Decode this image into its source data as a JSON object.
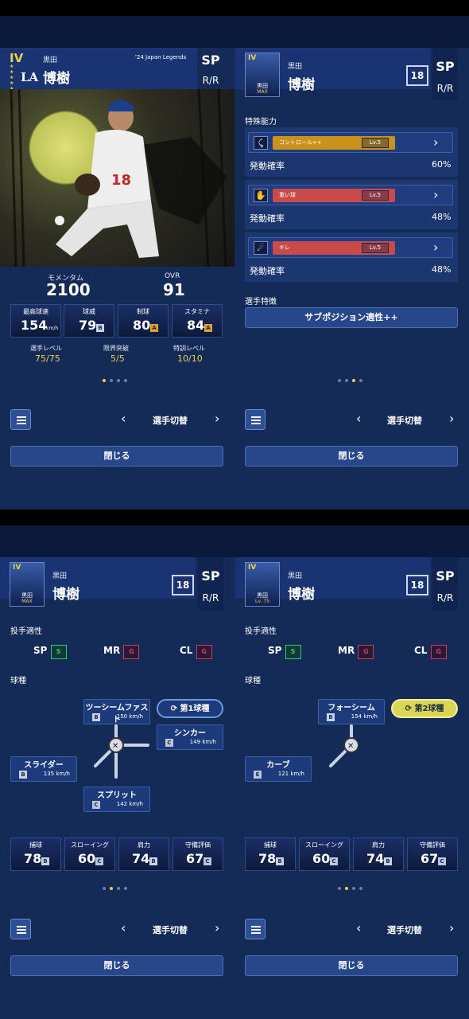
{
  "player": {
    "last_name": "黒田",
    "first_name": "博樹",
    "position": "SP",
    "throws_bats": "R/R",
    "number": "18",
    "series": "'24 Japan Legends",
    "grade": "IV",
    "team_logo": "LA",
    "thumb_max": "MAX",
    "thumb_lv": "Lv. 75"
  },
  "panel1": {
    "momentum_label": "モメンタム",
    "momentum_value": "2100",
    "ovr_label": "OVR",
    "ovr_value": "91",
    "stats": [
      {
        "label": "最高球速",
        "value": "154",
        "unit": "km/h"
      },
      {
        "label": "球威",
        "value": "79",
        "rank": "B"
      },
      {
        "label": "制球",
        "value": "80",
        "rank": "A"
      },
      {
        "label": "スタミナ",
        "value": "84",
        "rank": "A"
      }
    ],
    "levels": [
      {
        "label": "選手レベル",
        "value": "75/75"
      },
      {
        "label": "限界突破",
        "value": "5/5"
      },
      {
        "label": "特訓レベル",
        "value": "10/10"
      }
    ]
  },
  "panel2": {
    "special_title": "特殊能力",
    "rate_label": "発動確率",
    "skills": [
      {
        "name": "コントロール++",
        "lv": "Lv.5",
        "rate": "60%",
        "color": "#c9921a",
        "icon": "pitcher-throw-icon"
      },
      {
        "name": "重い球",
        "lv": "Lv.5",
        "rate": "48%",
        "color": "#c94a4a",
        "icon": "heavy-ball-icon"
      },
      {
        "name": "キレ",
        "lv": "Lv.5",
        "rate": "48%",
        "color": "#c94a4a",
        "icon": "sharp-break-icon"
      }
    ],
    "trait_title": "選手特徴",
    "trait_button": "サブポジション適性++"
  },
  "panel3": {
    "aptitude_title": "投手適性",
    "positions": [
      {
        "label": "SP",
        "rank": "S",
        "color": "#38c27a"
      },
      {
        "label": "MR",
        "rank": "G",
        "color": "#d23b4f"
      },
      {
        "label": "CL",
        "rank": "G",
        "color": "#d23b4f"
      }
    ],
    "pitch_title": "球種",
    "first_pitch_label": "第1球種",
    "pitches": [
      {
        "name": "ツーシームファスト",
        "rank": "B",
        "speed": "150 km/h"
      },
      {
        "name": "シンカー",
        "rank": "C",
        "speed": "149 km/h"
      },
      {
        "name": "スライダー",
        "rank": "B",
        "speed": "135 km/h"
      },
      {
        "name": "スプリット",
        "rank": "C",
        "speed": "142 km/h"
      }
    ]
  },
  "panel4": {
    "second_pitch_label": "第2球種",
    "pitches": [
      {
        "name": "フォーシーム",
        "rank": "B",
        "speed": "154 km/h"
      },
      {
        "name": "カーブ",
        "rank": "E",
        "speed": "121 km/h"
      }
    ]
  },
  "fielding": [
    {
      "label": "捕球",
      "value": "78",
      "rank": "B"
    },
    {
      "label": "スローイング",
      "value": "60",
      "rank": "C"
    },
    {
      "label": "肩力",
      "value": "74",
      "rank": "B"
    },
    {
      "label": "守備評価",
      "value": "67",
      "rank": "C"
    }
  ],
  "footer": {
    "switch_label": "選手切替",
    "close_label": "閉じる"
  },
  "colors": {
    "accent_yellow": "#e8d24a",
    "panel_bg": "#142b57"
  }
}
